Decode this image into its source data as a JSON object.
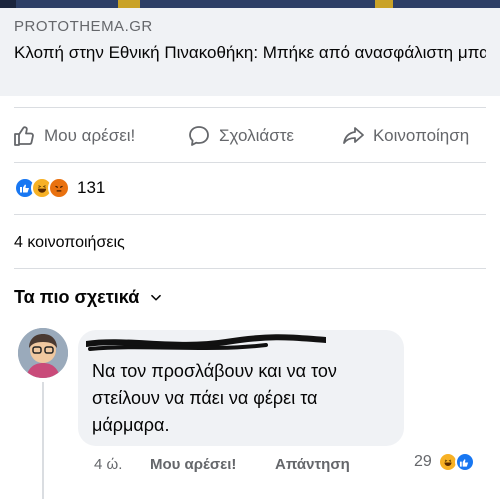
{
  "link_preview": {
    "domain": "PROTOTHEMA.GR",
    "title": "Κλοπή στην Εθνική Πινακοθήκη: Μπήκε από ανασφάλιστη μπαλκονόπορτα, πήρε τους πίνακες…"
  },
  "actions": {
    "like": "Μου αρέσει!",
    "comment": "Σχολιάστε",
    "share": "Κοινοποίηση"
  },
  "reactions": {
    "types": [
      "like-icon",
      "haha-icon",
      "angry-icon"
    ],
    "count": "131"
  },
  "shares_text": "4 κοινοποιήσεις",
  "sort": {
    "label": "Τα πιο σχετικά"
  },
  "comment": {
    "author": "",
    "text": "Να τον προσλάβουν και να τον στείλουν να πάει να φέρει τα μάρμαρα.",
    "time": "4 ώ.",
    "like_label": "Μου αρέσει!",
    "reply_label": "Απάντηση",
    "reaction_count": "29",
    "reaction_types": [
      "haha-icon",
      "like-icon"
    ]
  },
  "colors": {
    "accent": "#1877f2",
    "muted_text": "#65676b",
    "bubble_bg": "#f0f2f5",
    "haha": "#f7b125",
    "angry": "#e9710f"
  }
}
